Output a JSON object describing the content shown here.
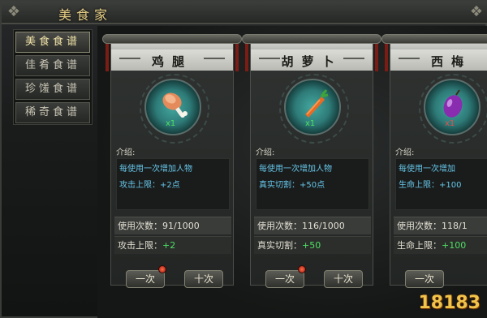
{
  "window": {
    "title": "美食家"
  },
  "sidebar": {
    "items": [
      {
        "label": "美食食谱",
        "active": true
      },
      {
        "label": "佳肴食谱",
        "active": false
      },
      {
        "label": "珍馐食谱",
        "active": false
      },
      {
        "label": "稀奇食谱",
        "active": false
      }
    ]
  },
  "cards": [
    {
      "name": "鸡腿",
      "icon": "chicken-leg-icon",
      "qty": "x1",
      "intro_label": "介绍:",
      "desc_line1": "每使用一次增加人物",
      "desc_line2": "攻击上限：+2点",
      "uses_label": "使用次数：91/1000",
      "stat_label": "攻击上限：",
      "stat_value": "+2",
      "btn_once": "一次",
      "btn_ten": "十次"
    },
    {
      "name": "胡萝卜",
      "icon": "carrot-icon",
      "qty": "x1",
      "intro_label": "介绍:",
      "desc_line1": "每使用一次增加人物",
      "desc_line2": "真实切割：+50点",
      "uses_label": "使用次数：116/1000",
      "stat_label": "真实切割：",
      "stat_value": "+50",
      "btn_once": "一次",
      "btn_ten": "十次"
    },
    {
      "name": "西梅",
      "icon": "plum-icon",
      "qty": "x1",
      "intro_label": "介绍:",
      "desc_line1": "每使用一次增加",
      "desc_line2": "生命上限：+100",
      "uses_label": "使用次数：118/1",
      "stat_label": "生命上限：",
      "stat_value": "+100",
      "btn_once": "一次",
      "btn_ten": "十次"
    }
  ],
  "watermark": "18183",
  "colors": {
    "accent_gold": "#e6cf86",
    "desc_blue": "#66c6ea",
    "stat_green": "#4ee062"
  }
}
